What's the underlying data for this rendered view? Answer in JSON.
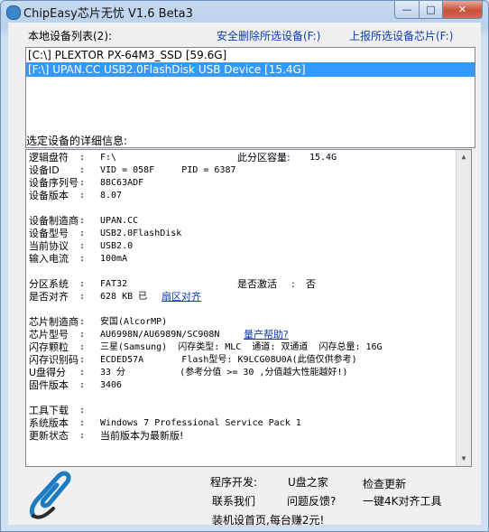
{
  "window": {
    "title": "ChipEasy芯片无忧 V1.6 Beta3",
    "controls": {
      "minimize": "—",
      "maximize": "□",
      "close": "✕"
    }
  },
  "header": {
    "device_list_label": "本地设备列表(2):",
    "safe_remove_link": "安全删除所选设备(F:)",
    "report_chip_link": "上报所选设备芯片(F:)"
  },
  "devices": [
    {
      "text": "[C:\\] PLEXTOR PX-64M3_SSD [59.6G]",
      "selected": false
    },
    {
      "text": "[F:\\] UPAN.CC USB2.0FlashDisk USB Device [15.4G]",
      "selected": true
    }
  ],
  "details_label": "选定设备的详细信息:",
  "details": {
    "drive_letter": {
      "key": "逻辑盘符",
      "value": "F:\\"
    },
    "partition_capacity": {
      "key": "此分区容量:",
      "value": "15.4G"
    },
    "device_id": {
      "key": "设备ID",
      "value": "VID = 058F     PID = 6387"
    },
    "serial": {
      "key": "设备序列号",
      "value": "88C63ADF"
    },
    "version": {
      "key": "设备版本",
      "value": "8.07"
    },
    "manufacturer": {
      "key": "设备制造商",
      "value": "UPAN.CC"
    },
    "model": {
      "key": "设备型号",
      "value": "USB2.0FlashDisk"
    },
    "protocol": {
      "key": "当前协议",
      "value": "USB2.0"
    },
    "current": {
      "key": "输入电流",
      "value": "100mA"
    },
    "fs": {
      "key": "分区系统",
      "value": "FAT32"
    },
    "activated": {
      "key": "是否激活",
      "sep": ":",
      "value": "否"
    },
    "aligned": {
      "key": "是否对齐",
      "value": "628 KB 已",
      "link": "扇区对齐"
    },
    "chip_vendor": {
      "key": "芯片制造商",
      "value": "安国(AlcorMP)"
    },
    "chip_model": {
      "key": "芯片型号",
      "value": "AU6998N/AU6989N/SC908N",
      "link": "量产帮助?"
    },
    "flash": {
      "key": "闪存颗粒",
      "value": "三星(Samsung)  闪存类型: MLC  通道: 双通道  闪存总量: 16G"
    },
    "flash_id": {
      "key": "闪存识别码",
      "value": "ECDED57A       Flash型号: K9LCG08U0A(此值仅供参考)"
    },
    "score": {
      "key": "U盘得分",
      "value": "33 分          (参考分值 >= 30 ,分值越大性能越好!)"
    },
    "firmware": {
      "key": "固件版本",
      "value": "3406"
    },
    "tool": {
      "key": "工具下载",
      "value": ""
    },
    "os": {
      "key": "系统版本",
      "value": "Windows 7 Professional Service Pack 1"
    },
    "update": {
      "key": "更新状态",
      "value": "当前版本为最新版!"
    }
  },
  "footer": {
    "developer_label": "程序开发:",
    "developer_link": "U盘之家",
    "check_update": "检查更新",
    "contact": "联系我们",
    "feedback": "问题反馈?",
    "align_tool": "一键4K对齐工具",
    "promo": "装机设首页,每台赚2元!"
  },
  "colors": {
    "selection": "#3399ff",
    "link": "#0a3cb4",
    "window_frame": "#b9d1ec"
  },
  "icons": {
    "logo": "paperclip-usb-logo"
  }
}
